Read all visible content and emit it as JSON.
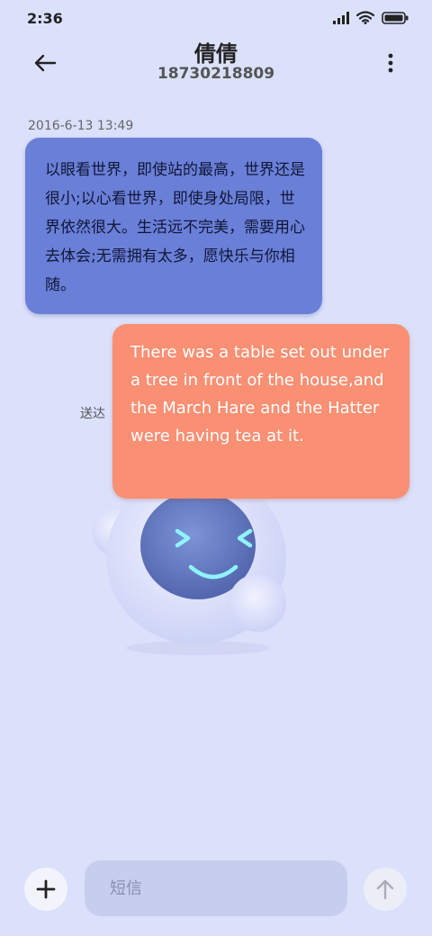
{
  "status_bar": {
    "time": "2:36",
    "icons": [
      "signal-icon",
      "wifi-icon",
      "battery-icon"
    ]
  },
  "header": {
    "contact_name": "倩倩",
    "contact_number": "18730218809",
    "back_icon": "back-arrow-icon",
    "more_icon": "more-vertical-icon"
  },
  "conversation": {
    "timestamp": "2016-6-13 13:49",
    "messages": [
      {
        "direction": "incoming",
        "text": "以眼看世界，即使站的最高，世界还是很小;以心看世界，即使身处局限，世界依然很大。生活远不完美，需要用心去体会;无需拥有太多，愿快乐与你相随。",
        "color": "#6a7fd8"
      },
      {
        "direction": "outgoing",
        "text": "There was a table set out under a tree in front of the house,and the March Hare and the Hatter were having tea at it.",
        "status": "送达",
        "color": "#f98f73"
      }
    ]
  },
  "composer": {
    "placeholder": "短信",
    "add_icon": "plus-icon",
    "send_icon": "send-arrow-icon"
  },
  "colors": {
    "background": "#dbe0fb",
    "incoming_bubble": "#6a7fd8",
    "outgoing_bubble": "#f98f73",
    "input_background": "#c7cdee"
  }
}
